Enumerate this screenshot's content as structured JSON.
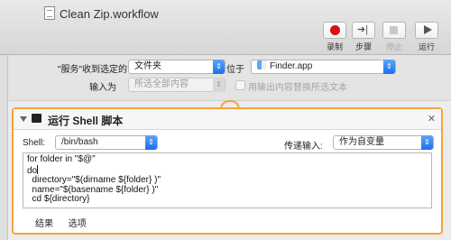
{
  "window": {
    "title": "Clean Zip.workflow"
  },
  "toolbar": {
    "record": {
      "label": "录制",
      "icon": "record-icon"
    },
    "step": {
      "label": "步骤",
      "icon": "step-icon"
    },
    "stop": {
      "label": "停止",
      "icon": "stop-icon"
    },
    "run": {
      "label": "运行",
      "icon": "play-icon"
    }
  },
  "service": {
    "receives_label": "\"服务\"收到选定的",
    "receives_value": "文件夹",
    "in_label": "位于",
    "app_value": "Finder.app",
    "input_is_label": "输入为",
    "input_is_value": "所选全部内容",
    "replace_label": "用输出内容替换所选文本",
    "replace_checked": false
  },
  "action": {
    "title": "运行 Shell 脚本",
    "shell_label": "Shell:",
    "shell_value": "/bin/bash",
    "pass_input_label": "传递输入:",
    "pass_input_value": "作为自变量",
    "code_lines": [
      "for folder in \"$@\"",
      "do",
      "  directory=\"$(dirname ${folder} )\"",
      "  name=\"$(basename ${folder} )\"",
      "  cd ${directory}"
    ],
    "tabs": [
      "结果",
      "选项"
    ]
  }
}
